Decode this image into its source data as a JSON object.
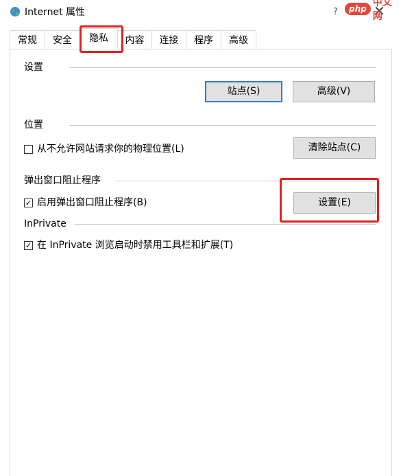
{
  "window": {
    "title": "Internet 属性",
    "help": "?",
    "close": "✕"
  },
  "watermark": {
    "logo": "php",
    "text": "中文网"
  },
  "tabs": [
    {
      "label": "常规"
    },
    {
      "label": "安全"
    },
    {
      "label": "隐私",
      "active": true
    },
    {
      "label": "内容"
    },
    {
      "label": "连接"
    },
    {
      "label": "程序"
    },
    {
      "label": "高级"
    }
  ],
  "settings_group": {
    "label": "设置",
    "sites_button": "站点(S)",
    "advanced_button": "高级(V)"
  },
  "location_group": {
    "label": "位置",
    "block_location_checkbox": {
      "label": "从不允许网站请求你的物理位置(L)",
      "checked": false
    },
    "clear_sites_button": "清除站点(C)"
  },
  "popup_group": {
    "label": "弹出窗口阻止程序",
    "enable_popup_blocker_checkbox": {
      "label": "启用弹出窗口阻止程序(B)",
      "checked": true
    },
    "settings_button": "设置(E)"
  },
  "inprivate_group": {
    "label": "InPrivate",
    "disable_toolbars_checkbox": {
      "label": "在 InPrivate 浏览启动时禁用工具栏和扩展(T)",
      "checked": true
    }
  },
  "colors": {
    "highlight_red": "#e02020",
    "default_button_border": "#2f7cd6",
    "button_face": "#e1e1e1"
  }
}
